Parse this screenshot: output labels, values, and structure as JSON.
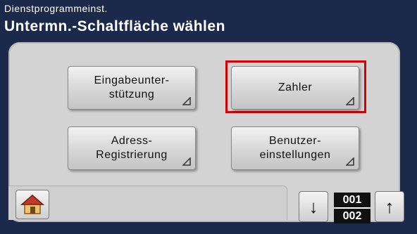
{
  "header": {
    "subtitle": "Dienstprogrammeinst.",
    "title": "Untermn.-Schaltfläche wählen"
  },
  "buttons": {
    "eingabe": "Eingabeunter-\nstützung",
    "zahler": "Zahler",
    "adress": "Adress-\nRegistrierung",
    "benutzer": "Benutzer-\neinstellungen"
  },
  "footer": {
    "home_icon": "home-icon",
    "down_arrow": "↓",
    "up_arrow": "↑",
    "page_current": "001",
    "page_total": "002"
  },
  "colors": {
    "header_bg": "#1b2a4a",
    "panel_bg": "#d3d3d3",
    "highlight": "#d40000"
  }
}
